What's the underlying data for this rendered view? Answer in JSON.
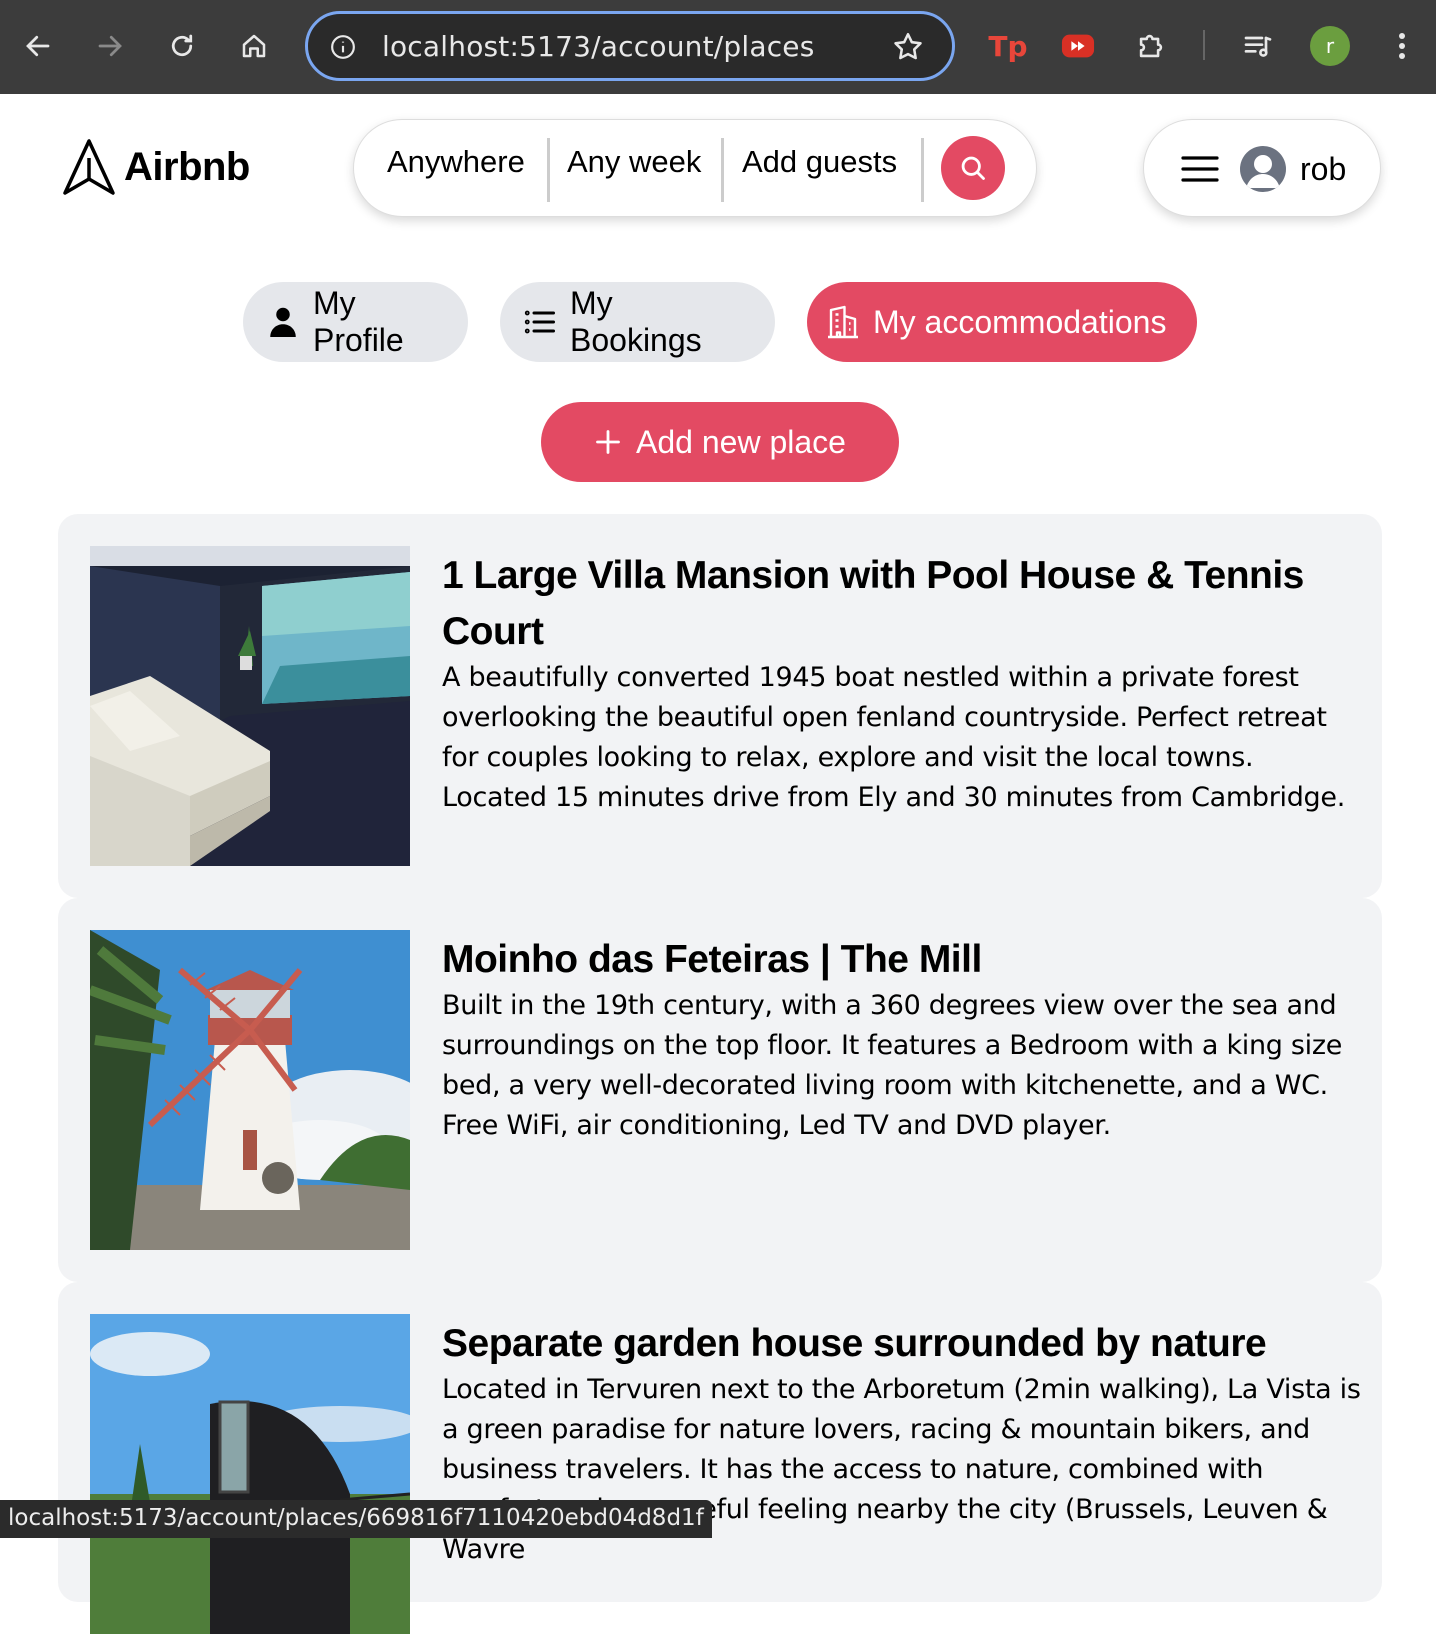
{
  "browser": {
    "url": "localhost:5173/account/places",
    "profile_initial": "r",
    "extension_tp": "Tp",
    "status_url": "localhost:5173/account/places/669816f7110420ebd04d8d1f"
  },
  "header": {
    "logo_text": "Airbnb",
    "search": {
      "where": "Anywhere",
      "when": "Any week",
      "who": "Add guests"
    },
    "username": "rob"
  },
  "tabs": [
    {
      "label": "My Profile",
      "icon": "person-icon",
      "active": false
    },
    {
      "label": "My Bookings",
      "icon": "list-icon",
      "active": false
    },
    {
      "label": "My accommodations",
      "icon": "building-icon",
      "active": true
    }
  ],
  "add_place_label": "Add new place",
  "colors": {
    "primary": "#e34a63",
    "card_bg": "#f2f3f5",
    "chrome_bg": "#3c3c3c"
  },
  "places": [
    {
      "title": "1 Large Villa Mansion with Pool House & Tennis Court",
      "description": "A beautifully converted 1945 boat nestled within a private forest overlooking the beautiful open fenland countryside. Perfect retreat for couples looking to relax, explore and visit the local towns. Located 15 minutes drive from Ely and 30 minutes from Cambridge."
    },
    {
      "title": "Moinho das Feteiras | The Mill",
      "description": "Built in the 19th century, with a 360 degrees view over the sea and surroundings on the top floor. It features a Bedroom with a king size bed, a very well-decorated living room with kitchenette, and a WC. Free WiFi, air conditioning, Led TV and DVD player."
    },
    {
      "title": "Separate garden house surrounded by nature",
      "description": "Located in Tervuren next to the Arboretum (2min walking), La Vista is a green paradise for nature lovers, racing & mountain bikers, and business travelers. It has the access to nature, combined with comfort and a peaceful feeling nearby the city (Brussels, Leuven & Wavre"
    }
  ]
}
